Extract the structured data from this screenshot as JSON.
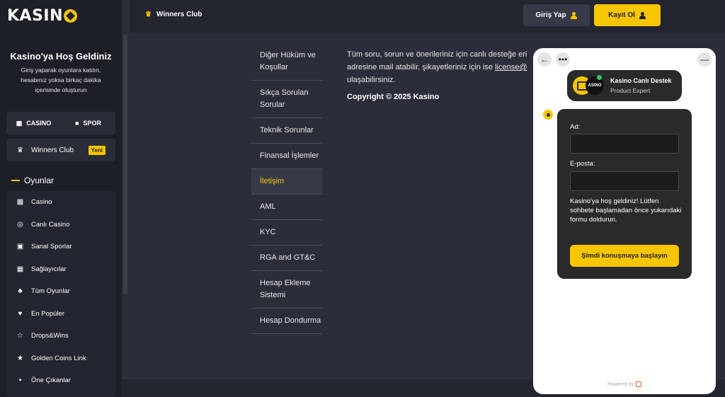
{
  "brand": {
    "logo_text": "KASIN",
    "accent": "#f7c600"
  },
  "sidebar": {
    "welcome_title": "Kasino'ya Hoş Geldiniz",
    "welcome_text": "Giriş yaparak oyunlara katılın, hesabınız yoksa birkaç dakika içerisinde oluşturun",
    "tabs": [
      {
        "label": "CASINO",
        "icon": "slot-icon"
      },
      {
        "label": "SPOR",
        "icon": "jersey-icon"
      }
    ],
    "winners_club": {
      "label": "Winners Club",
      "badge": "Yeni"
    },
    "games_heading": "Oyunlar",
    "games": [
      {
        "label": "Casino",
        "icon": "slot-machine-icon"
      },
      {
        "label": "Canlı Casino",
        "icon": "roulette-icon"
      },
      {
        "label": "Sanal Sporlar",
        "icon": "gamepad-icon"
      },
      {
        "label": "Sağlayıcılar",
        "icon": "grid-icon"
      },
      {
        "label": "Tüm Oyunlar",
        "icon": "cherry-icon"
      },
      {
        "label": "En Popüler",
        "icon": "heart-icon"
      },
      {
        "label": "Drops&Wins",
        "icon": "trophy-icon"
      },
      {
        "label": "Golden Coins Link",
        "icon": "cup-icon"
      },
      {
        "label": "Öne Çıkanlar",
        "icon": "gift-icon"
      }
    ]
  },
  "header": {
    "winners_club": "Winners Club",
    "login_label": "Giriş Yap",
    "register_label": "Kayıt Ol"
  },
  "menu": {
    "items": [
      "Diğer Hüküm ve Koşullar",
      "Sıkça Sorulan Sorular",
      "Teknik Sorunlar",
      "Finansal İşlemler",
      "İletişim",
      "AML",
      "KYC",
      "RGA and GT&C",
      "Hesap Ekleme Sistemi",
      "Hesap Dondurma"
    ],
    "active": "İletişim"
  },
  "content": {
    "text_1": "Tüm soru, sorun ve önerileriniz için canlı desteğe eri",
    "text_2": "adresine mail atabilir, şikayetleriniz için ise ",
    "link": "license@",
    "text_3": "ulaşabilirsiniz.",
    "copyright": "Copyright © 2025 Kasino"
  },
  "chat": {
    "agent_name": "Kasino Canlı Destek",
    "agent_role": "Product Expert",
    "avatar_text": "ASINO",
    "name_label": "Ad:",
    "email_label": "E-posta:",
    "note": "Kasino'ya hoş geldiniz! Lütfen sohbete başlamadan önce yukarıdaki formu doldurun.",
    "submit": "Şimdi konuşmaya başlayın",
    "powered": "Powered by"
  }
}
